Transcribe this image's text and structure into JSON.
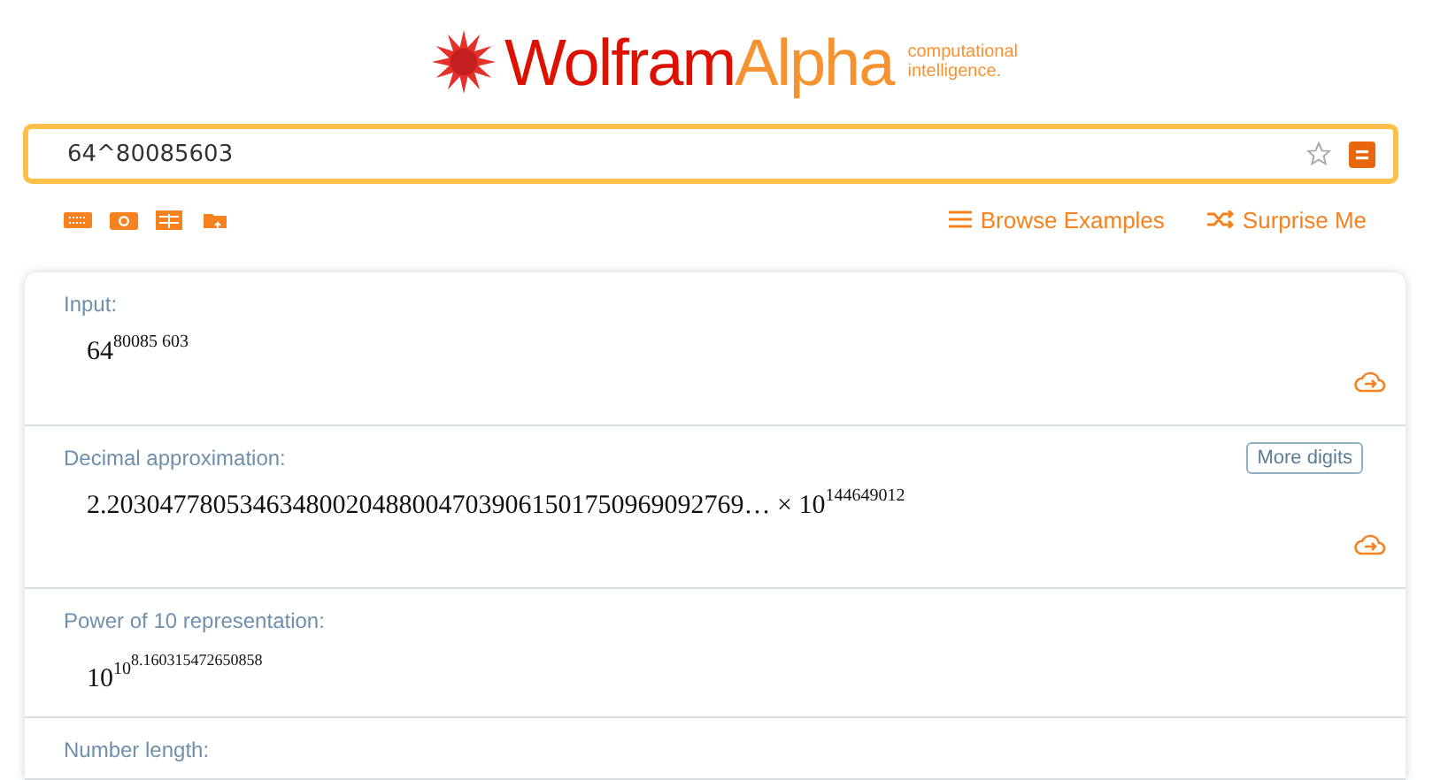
{
  "logo": {
    "word_1": "Wolfram",
    "word_2": "Alpha",
    "tagline_1": "computational",
    "tagline_2": "intelligence."
  },
  "search": {
    "value": "64^80085603"
  },
  "links": [
    {
      "kind": "menu",
      "label": "Browse Examples"
    },
    {
      "kind": "shuffle",
      "label": "Surprise Me"
    }
  ],
  "pods": [
    {
      "title": "Input:",
      "math": {
        "base": "64",
        "exponent": "80085 603"
      },
      "share": true
    },
    {
      "title": "Decimal approximation:",
      "button": "More digits",
      "math": {
        "mantissa": "2.2030477805346348002048800470390615017509690927​69…",
        "times": "×",
        "base": "10",
        "exponent": "144649012"
      },
      "share": true
    },
    {
      "title": "Power of 10 representation:",
      "math": {
        "base": "10",
        "exponent": "10",
        "inner_exponent": "8.160315472650858"
      },
      "share": false
    },
    {
      "title": "Number length:",
      "share": false
    }
  ]
}
